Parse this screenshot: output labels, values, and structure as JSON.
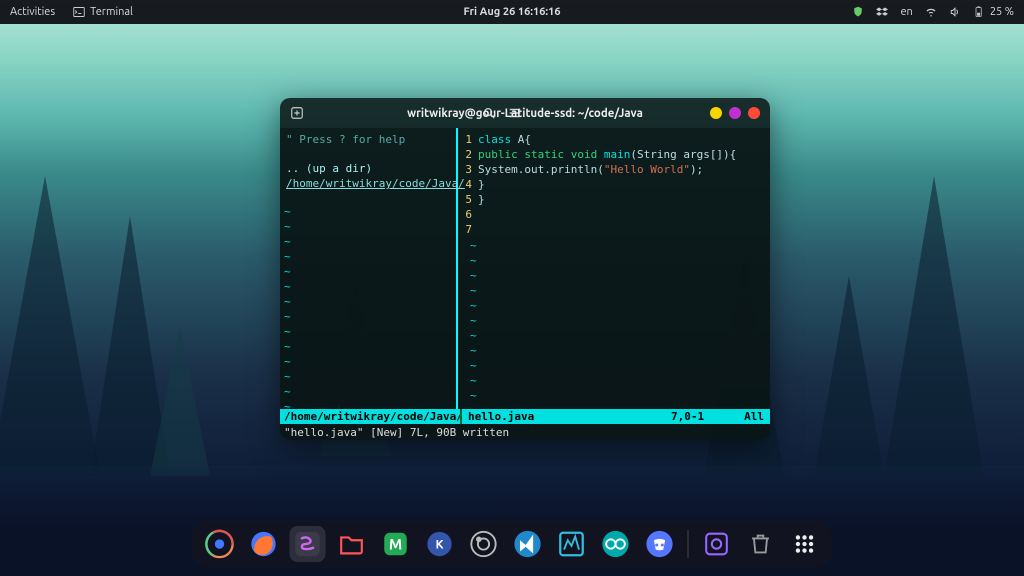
{
  "topbar": {
    "activities": "Activities",
    "app_indicator": "Terminal",
    "clock": "Fri Aug 26  16:16:16",
    "lang": "en",
    "battery": "25 %"
  },
  "terminal": {
    "title": "writwikray@gour-Latitude-ssd: ~/code/Java",
    "help_hint": "\" Press ? for help",
    "updir_label": ".. (up a dir)",
    "cwd_path": "/home/writwikray/code/Java/",
    "code_lines": [
      {
        "n": "1",
        "tokens": [
          {
            "t": "class ",
            "c": "kw-cyan"
          },
          {
            "t": "A{",
            "c": "plain"
          }
        ]
      },
      {
        "n": "2",
        "tokens": [
          {
            "t": "public static void ",
            "c": "kw-green"
          },
          {
            "t": "main",
            "c": "func"
          },
          {
            "t": "(String args[]){",
            "c": "plain"
          }
        ]
      },
      {
        "n": "3",
        "tokens": [
          {
            "t": "System.out.println(",
            "c": "plain"
          },
          {
            "t": "\"Hello World\"",
            "c": "str"
          },
          {
            "t": ");",
            "c": "plain"
          }
        ]
      },
      {
        "n": "4",
        "tokens": [
          {
            "t": "}",
            "c": "plain"
          }
        ]
      },
      {
        "n": "5",
        "tokens": [
          {
            "t": "}",
            "c": "plain"
          }
        ]
      },
      {
        "n": "6",
        "tokens": []
      },
      {
        "n": "7",
        "tokens": []
      }
    ],
    "status_left": "/home/writwikray/code/Java/",
    "status_file": "hello.java",
    "status_pos": "7,0-1",
    "status_all": "All",
    "message": "\"hello.java\" [New] 7L, 90B written"
  },
  "dock": {
    "apps": [
      "chrome",
      "firefox",
      "emacs",
      "files",
      "mail",
      "kdenlive",
      "obs",
      "vscode",
      "matlab",
      "arduino",
      "discord"
    ]
  },
  "colors": {
    "dot_min": "#f5d400",
    "dot_max": "#c030d0",
    "dot_close": "#ff4a3a"
  }
}
